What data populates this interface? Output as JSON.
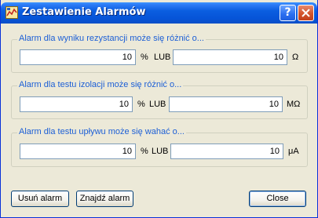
{
  "window": {
    "title": "Zestawienie Alarmów",
    "help_label": "?",
    "close_label": "✕"
  },
  "groups": [
    {
      "legend": "Alarm dla wyniku rezystancji może się różnić o...",
      "percent_value": "10",
      "percent_unit": "%",
      "or_label": "LUB",
      "abs_value": "10",
      "abs_unit": "Ω"
    },
    {
      "legend": "Alarm dla testu izolacji może się różnić o...",
      "percent_value": "10",
      "percent_unit": "%",
      "or_label": "LUB",
      "abs_value": "10",
      "abs_unit": "MΩ"
    },
    {
      "legend": "Alarm dla testu upływu może się wahać o...",
      "percent_value": "10",
      "percent_unit": "%",
      "or_label": "LUB",
      "abs_value": "10",
      "abs_unit": "μA"
    }
  ],
  "buttons": {
    "remove": "Usuń alarm",
    "find": "Znajdź alarm",
    "close": "Close"
  },
  "colors": {
    "titlebar": "#0654d8",
    "legend_text": "#1c5fd6",
    "window_bg": "#ece9d8"
  }
}
